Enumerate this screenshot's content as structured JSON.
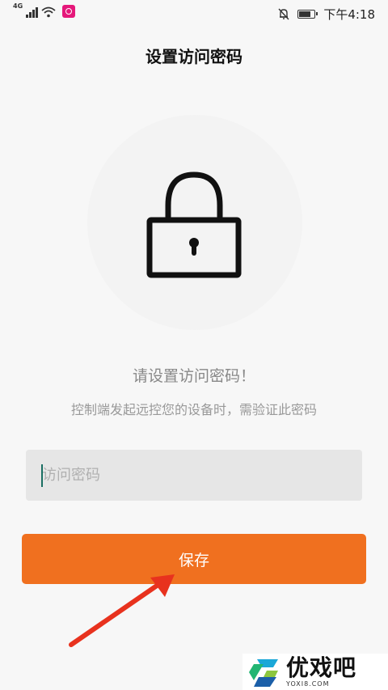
{
  "status_bar": {
    "network": "4G",
    "time": "下午4:18",
    "icons": [
      "signal-icon",
      "wifi-icon",
      "app-notification-icon",
      "bell-muted-icon",
      "battery-icon"
    ],
    "battery_level": 0.8
  },
  "header": {
    "title": "设置访问密码"
  },
  "illustration": {
    "icon": "lock-icon"
  },
  "prompt": {
    "title": "请设置访问密码！",
    "subtitle": "控制端发起远控您的设备时，需验证此密码"
  },
  "password_field": {
    "placeholder": "访问密码",
    "value": ""
  },
  "save_button": {
    "label": "保存"
  },
  "colors": {
    "accent": "#f0701f",
    "background": "#f7f7f7",
    "input_bg": "#e6e6e6",
    "arrow": "#e8321e"
  },
  "watermark": {
    "name_cn": "优戏吧",
    "name_en": "YOXI8.COM"
  }
}
